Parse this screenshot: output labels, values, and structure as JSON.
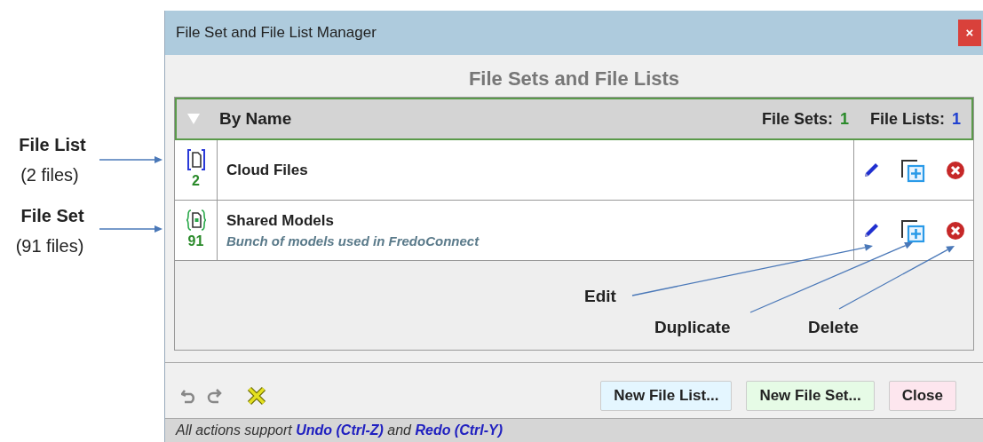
{
  "window": {
    "title": "File Set and File List Manager",
    "close": "×"
  },
  "heading": "File Sets and File Lists",
  "table_header": {
    "sort_label": "By Name",
    "file_sets_label": "File Sets:",
    "file_sets_count": "1",
    "file_lists_label": "File Lists:",
    "file_lists_count": "1"
  },
  "rows": [
    {
      "kind": "list",
      "count": "2",
      "name": "Cloud Files"
    },
    {
      "kind": "set",
      "count": "91",
      "name": "Shared Models",
      "description": "Bunch of models used in FredoConnect"
    }
  ],
  "buttons": [
    {
      "label": "New File List...",
      "kind": "list"
    },
    {
      "label": "New File Set...",
      "kind": "set"
    },
    {
      "label": "Close",
      "kind": "close"
    }
  ],
  "status_bar": "All actions support **Undo (Ctrl-Z)** and **Redo (Ctrl-Y)**",
  "side_annotations": [
    {
      "title": "File List",
      "subtitle": "(2 files)"
    },
    {
      "title": "File Set",
      "subtitle": "(91 files)"
    }
  ],
  "callouts": [
    "Edit",
    "Duplicate",
    "Delete"
  ]
}
